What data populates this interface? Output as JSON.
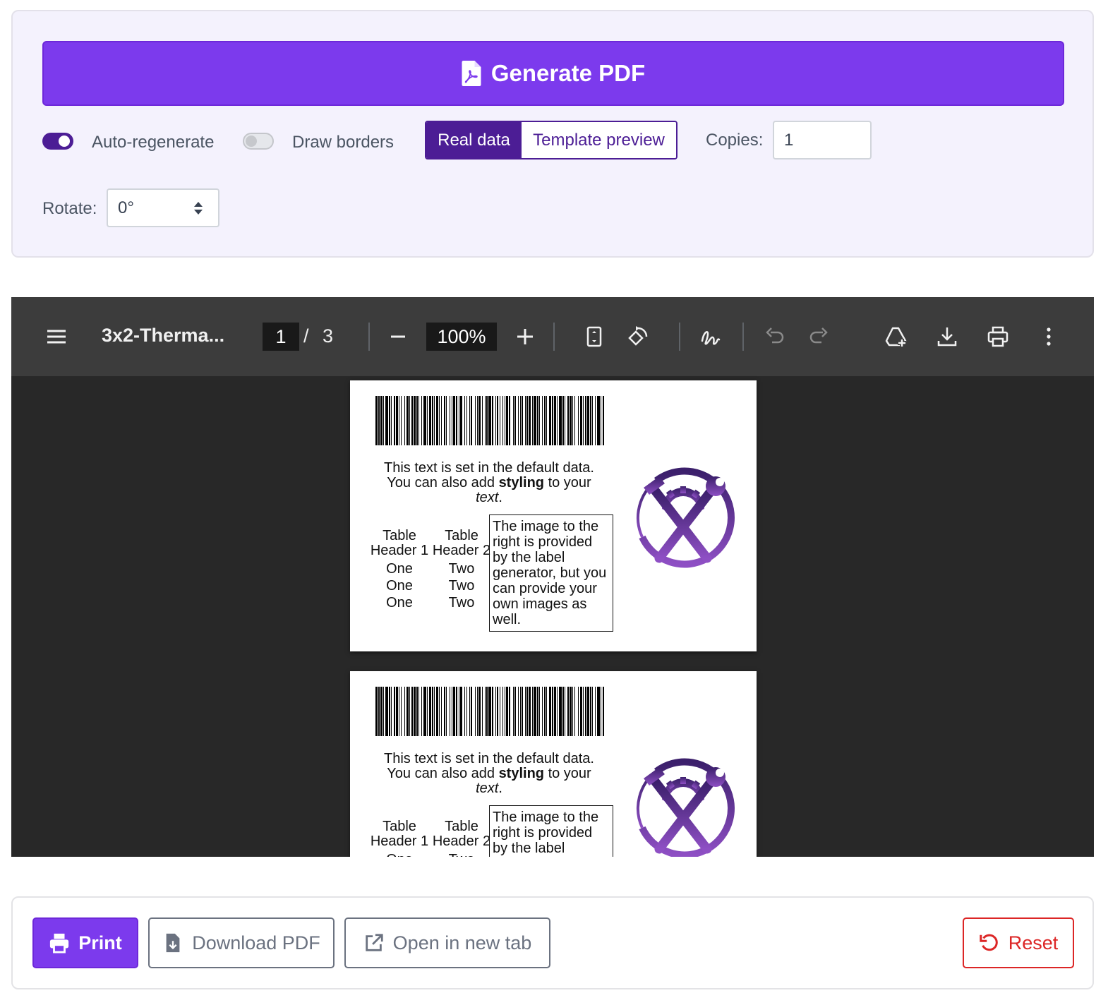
{
  "controls": {
    "generate_label": "Generate PDF",
    "auto_regenerate_label": "Auto-regenerate",
    "auto_regenerate_on": true,
    "draw_borders_label": "Draw borders",
    "draw_borders_on": false,
    "mode_options": [
      "Real data",
      "Template preview"
    ],
    "mode_selected": "Real data",
    "copies_label": "Copies:",
    "copies_value": "1",
    "rotate_label": "Rotate:",
    "rotate_value": "0°"
  },
  "viewer": {
    "title": "3x2-Therma...",
    "page_current": "1",
    "page_separator": "/",
    "page_total": "3",
    "zoom": "100%",
    "minus_glyph": "–",
    "plus_glyph": "+"
  },
  "label": {
    "desc_line1": "This text is set in the default data.",
    "desc_line2_pre": "You can also add ",
    "desc_bold": "styling",
    "desc_line2_post": " to your",
    "desc_italic": "text",
    "desc_end": ".",
    "table_headers": [
      "Table Header 1",
      "Table Header 2"
    ],
    "table_rows": [
      [
        "One",
        "Two"
      ],
      [
        "One",
        "Two"
      ],
      [
        "One",
        "Two"
      ]
    ],
    "image_note": "The image to the right is provided by the label generator, but you can provide your own images as well."
  },
  "footer": {
    "print_label": "Print",
    "download_label": "Download PDF",
    "open_tab_label": "Open in new tab",
    "reset_label": "Reset"
  },
  "colors": {
    "accent": "#7c3aed",
    "accent_dark": "#4c1d95",
    "viewer_bg": "#282828",
    "toolbar_bg": "#3c3c3c",
    "danger": "#dc2626"
  }
}
